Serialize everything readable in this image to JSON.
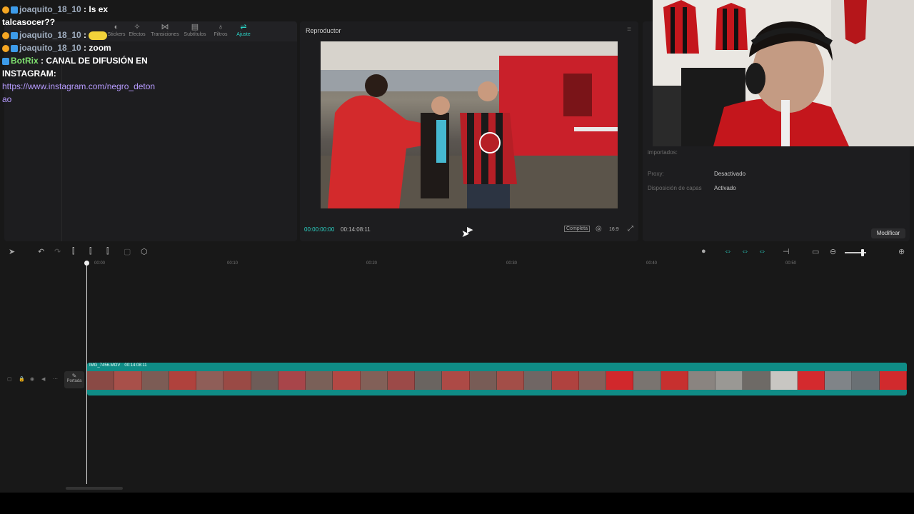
{
  "chat": {
    "messages": [
      {
        "user": "joaquito_18_10",
        "text": ": Is ex talcasocer??"
      },
      {
        "user": "joaquito_18_10",
        "text": ":"
      },
      {
        "user": "joaquito_18_10",
        "text": ": zoom"
      },
      {
        "user": "BotRix",
        "text": ": CANAL DE DIFUSIÓN EN INSTAGRAM:",
        "link": "https://www.instagram.com/negro_detonao"
      }
    ]
  },
  "media_toolbar": {
    "items": [
      {
        "label": "Stickers",
        "icon": "sticker-icon"
      },
      {
        "label": "Efectos",
        "icon": "effects-icon"
      },
      {
        "label": "Transiciones",
        "icon": "transitions-icon"
      },
      {
        "label": "Subtítulos",
        "icon": "subtitles-icon"
      },
      {
        "label": "Filtros",
        "icon": "filters-icon"
      },
      {
        "label": "Ajuste",
        "icon": "adjust-icon",
        "active": true
      }
    ]
  },
  "player": {
    "title": "Reproductor",
    "current_time": "00:00:00:00",
    "total_time": "00:14:08:11",
    "quality_label": "Completa",
    "ratio_label": "16:9"
  },
  "properties": {
    "imported_label": "importados:",
    "rows": [
      {
        "label": "Proxy:",
        "value": "Desactivado"
      },
      {
        "label": "Disposición de capas",
        "value": "Activado"
      }
    ],
    "modify_button": "Modificar"
  },
  "timeline": {
    "ruler_ticks": [
      "00:00",
      "00:10",
      "00:20",
      "00:30",
      "00:40",
      "00:50"
    ],
    "cover_label": "Portada",
    "clip": {
      "name": "IMG_7456.MOV",
      "duration": "00:14:08:11"
    }
  },
  "colors": {
    "accent": "#2bd4c6",
    "clip": "#0f8c86"
  }
}
